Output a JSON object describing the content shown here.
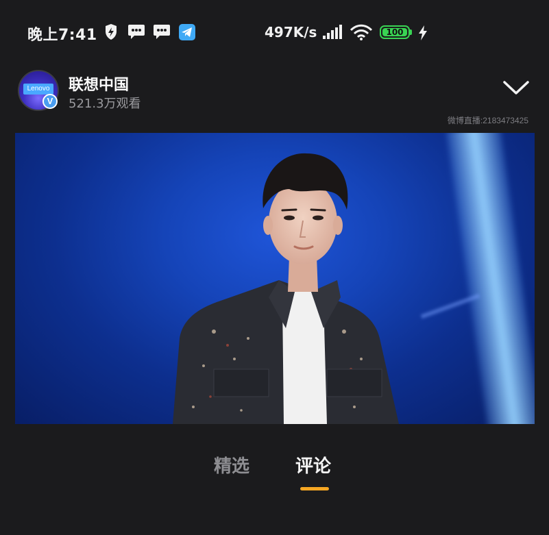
{
  "status_bar": {
    "time": "晚上7:41",
    "icons": [
      "shield-bolt-icon",
      "message-icon",
      "message-icon",
      "telegram-icon"
    ],
    "network_speed": "497K/s",
    "signal_icon": "signal-bars-icon",
    "wifi_icon": "wifi-icon",
    "battery_level": "100",
    "charging_icon": "bolt-icon"
  },
  "header": {
    "channel_name": "联想中国",
    "viewers": "521.3万观看",
    "avatar_logo": "Lenovo",
    "verified_badge": "V",
    "weibo_live_id": "微博直播:2183473425"
  },
  "video": {
    "content": "live-stream-performer"
  },
  "tabs": [
    {
      "label": "精选",
      "active": false
    },
    {
      "label": "评论",
      "active": true
    }
  ],
  "colors": {
    "background": "#1b1b1d",
    "accent": "#f5a623",
    "battery": "#39d353",
    "verified": "#4a9df0"
  }
}
